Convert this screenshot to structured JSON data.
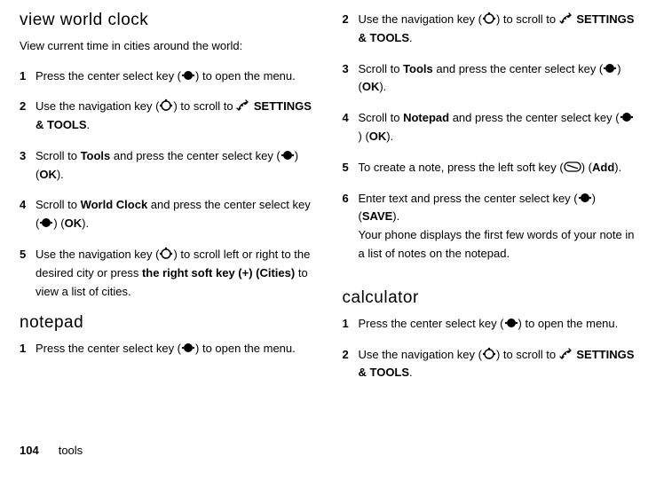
{
  "left": {
    "heading_world_clock": "view world clock",
    "intro_world_clock": "View current time in cities around the world:",
    "steps_world_clock": {
      "s1": {
        "num": "1",
        "pre": "Press the center select key (",
        "post": ") to open the menu."
      },
      "s2": {
        "num": "2",
        "pre": "Use the navigation key (",
        "post_a": ") to scroll to ",
        "settings": "SETTINGS & TOOLS",
        "post_b": "."
      },
      "s3": {
        "num": "3",
        "pre": "Scroll to ",
        "tools": "Tools",
        "mid": " and press the center select key (",
        "ok": "OK",
        "post": ")."
      },
      "s4": {
        "num": "4",
        "pre": "Scroll to ",
        "worldclock": "World Clock",
        "mid": " and press the center select key (",
        "ok": "OK",
        "post": ")."
      },
      "s5": {
        "num": "5",
        "pre": "Use the navigation key (",
        "mid": ") to scroll left or right to the desired city or press ",
        "rsk": "the right soft key (+) (Cities)",
        "post": " to view a list of cities."
      }
    },
    "heading_notepad": "notepad",
    "steps_notepad": {
      "s1": {
        "num": "1",
        "pre": "Press the center select key (",
        "post": ") to open the menu."
      }
    }
  },
  "right": {
    "steps_notepad_cont": {
      "s2": {
        "num": "2",
        "pre": "Use the navigation key (",
        "post_a": ") to scroll to ",
        "settings": "SETTINGS & TOOLS",
        "post_b": "."
      },
      "s3": {
        "num": "3",
        "pre": "Scroll to ",
        "tools": "Tools",
        "mid": " and press the center select key (",
        "ok": "OK",
        "post": ")."
      },
      "s4": {
        "num": "4",
        "pre": "Scroll to ",
        "notepad": "Notepad",
        "mid": " and press the center select key (",
        "ok": "OK",
        "post": ")."
      },
      "s5": {
        "num": "5",
        "pre": "To create a note, press the left soft key (",
        "add": "Add",
        "post": ")."
      },
      "s6": {
        "num": "6",
        "pre": "Enter text and press the center select key (",
        "save": "SAVE",
        "post": ")."
      },
      "note": "Your phone displays the first few words of your note in a list of notes on the notepad."
    },
    "heading_calc": "calculator",
    "steps_calc": {
      "s1": {
        "num": "1",
        "pre": "Press the center select key (",
        "post": ") to open the menu."
      },
      "s2": {
        "num": "2",
        "pre": "Use the navigation key (",
        "post_a": ") to scroll to ",
        "settings": "SETTINGS & TOOLS",
        "post_b": "."
      }
    }
  },
  "footer": {
    "pagenum": "104",
    "section": "tools"
  }
}
